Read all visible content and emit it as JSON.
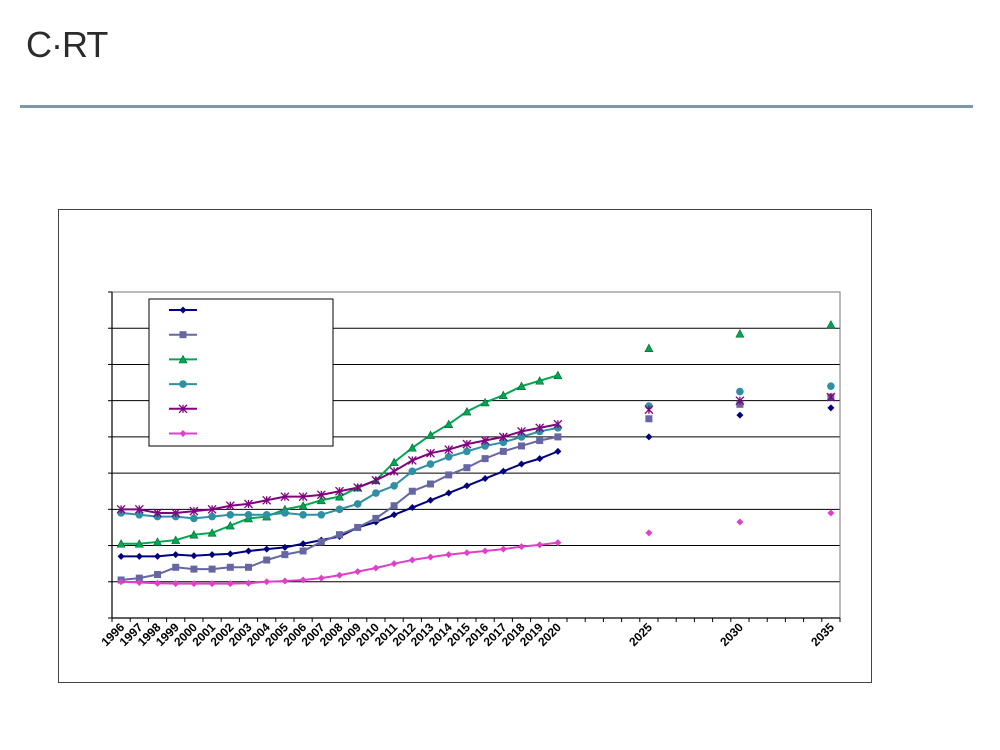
{
  "header": {
    "logo": "C·RT"
  },
  "chart_data": {
    "type": "line",
    "x_labels": [
      "1996",
      "1997",
      "1998",
      "1999",
      "2000",
      "2001",
      "2002",
      "2003",
      "2004",
      "2005",
      "2006",
      "2007",
      "2008",
      "2009",
      "2010",
      "2011",
      "2012",
      "2013",
      "2014",
      "2015",
      "2016",
      "2017",
      "2018",
      "2019",
      "2020",
      "",
      "",
      "",
      "",
      "2025",
      "",
      "",
      "",
      "",
      "2030",
      "",
      "",
      "",
      "",
      "2035"
    ],
    "grid": true,
    "legend": "top-left",
    "ylim": [
      0,
      9
    ],
    "series": [
      {
        "color": "#00007f",
        "marker": "diamond",
        "values": [
          1.7,
          1.7,
          1.7,
          1.75,
          1.72,
          1.75,
          1.77,
          1.85,
          1.9,
          1.95,
          2.05,
          2.15,
          2.25,
          2.5,
          2.65,
          2.85,
          3.05,
          3.25,
          3.45,
          3.65,
          3.85,
          4.05,
          4.25,
          4.4,
          4.6,
          null,
          null,
          null,
          null,
          5.0,
          null,
          null,
          null,
          null,
          5.6,
          null,
          null,
          null,
          null,
          5.8
        ]
      },
      {
        "color": "#6666a3",
        "marker": "square",
        "values": [
          1.05,
          1.1,
          1.2,
          1.4,
          1.35,
          1.35,
          1.4,
          1.4,
          1.6,
          1.75,
          1.85,
          2.1,
          2.3,
          2.5,
          2.75,
          3.1,
          3.5,
          3.7,
          3.95,
          4.15,
          4.4,
          4.6,
          4.75,
          4.9,
          5.0,
          null,
          null,
          null,
          null,
          5.5,
          null,
          null,
          null,
          null,
          5.9,
          null,
          null,
          null,
          null,
          6.1
        ]
      },
      {
        "color": "#00a651",
        "marker": "triangle",
        "values": [
          2.05,
          2.05,
          2.1,
          2.15,
          2.3,
          2.35,
          2.55,
          2.75,
          2.8,
          3.0,
          3.1,
          3.25,
          3.35,
          3.6,
          3.8,
          4.3,
          4.7,
          5.05,
          5.35,
          5.7,
          5.95,
          6.15,
          6.4,
          6.55,
          6.7,
          null,
          null,
          null,
          null,
          7.45,
          null,
          null,
          null,
          null,
          7.85,
          null,
          null,
          null,
          null,
          8.1
        ]
      },
      {
        "color": "#2f8fa3",
        "marker": "circle",
        "values": [
          2.9,
          2.85,
          2.8,
          2.8,
          2.75,
          2.8,
          2.85,
          2.85,
          2.85,
          2.9,
          2.85,
          2.85,
          3.0,
          3.15,
          3.45,
          3.65,
          4.05,
          4.25,
          4.45,
          4.6,
          4.75,
          4.85,
          5.0,
          5.15,
          5.25,
          null,
          null,
          null,
          null,
          5.85,
          null,
          null,
          null,
          null,
          6.25,
          null,
          null,
          null,
          null,
          6.4
        ]
      },
      {
        "color": "#800080",
        "marker": "asterisk",
        "values": [
          3.0,
          3.0,
          2.9,
          2.9,
          2.95,
          3.0,
          3.1,
          3.15,
          3.25,
          3.35,
          3.35,
          3.4,
          3.5,
          3.6,
          3.8,
          4.05,
          4.35,
          4.55,
          4.65,
          4.8,
          4.9,
          5.0,
          5.15,
          5.25,
          5.35,
          null,
          null,
          null,
          null,
          5.75,
          null,
          null,
          null,
          null,
          6.0,
          null,
          null,
          null,
          null,
          6.1
        ]
      },
      {
        "color": "#e040c8",
        "marker": "diamond",
        "values": [
          1.0,
          0.98,
          0.96,
          0.95,
          0.95,
          0.95,
          0.95,
          0.96,
          1.0,
          1.02,
          1.05,
          1.1,
          1.18,
          1.28,
          1.38,
          1.5,
          1.6,
          1.68,
          1.75,
          1.8,
          1.85,
          1.9,
          1.97,
          2.02,
          2.08,
          null,
          null,
          null,
          null,
          2.35,
          null,
          null,
          null,
          null,
          2.65,
          null,
          null,
          null,
          null,
          2.9
        ]
      }
    ]
  }
}
